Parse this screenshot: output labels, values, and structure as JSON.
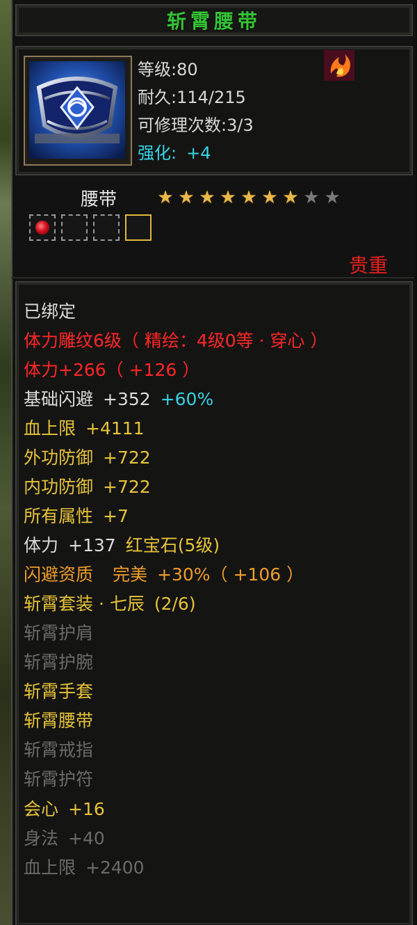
{
  "title": "斩霄腰带",
  "header": {
    "level": "等级:80",
    "durability": "耐久:114/215",
    "repair": "可修理次数:3/3",
    "enhance_label": "强化:",
    "enhance_value": "+4",
    "item_icon": "belt-icon",
    "class_icon": "flame-swirl-icon"
  },
  "type_label": "腰带",
  "stars": {
    "filled": 7,
    "total": 9
  },
  "gem_slots": [
    {
      "state": "red-gem"
    },
    {
      "state": "empty"
    },
    {
      "state": "empty"
    },
    {
      "state": "gold-empty"
    }
  ],
  "rarity": "贵重",
  "lines": {
    "bound": "已绑定",
    "engrave": "体力雕纹6级（ 精绘：4级0等 · 穿心 ）",
    "stamina_main": "体力+266（ +126 ）",
    "dodge_label": "基础闪避",
    "dodge_value": "+352",
    "dodge_pct": "+60%",
    "hp_label": "血上限",
    "hp_value": "+4111",
    "outer_def_label": "外功防御",
    "outer_def_value": "+722",
    "inner_def_label": "内功防御",
    "inner_def_value": "+722",
    "all_attr_label": "所有属性",
    "all_attr_value": "+7",
    "gem_stat_label": "体力",
    "gem_stat_value": "+137",
    "gem_name": "红宝石(5级)",
    "quality_label": "闪避资质",
    "quality_grade": "完美",
    "quality_value": "+30%（ +106 ）",
    "set_name": "斩霄套装 · 七辰",
    "set_count": "(2/6)",
    "set_piece_1": "斩霄护肩",
    "set_piece_2": "斩霄护腕",
    "set_piece_3": "斩霄手套",
    "set_piece_4": "斩霄腰带",
    "set_piece_5": "斩霄戒指",
    "set_piece_6": "斩霄护符",
    "bonus_1_label": "会心",
    "bonus_1_value": "+16",
    "bonus_2_label": "身法",
    "bonus_2_value": "+40",
    "bonus_3_label": "血上限",
    "bonus_3_value": "+2400"
  },
  "colors": {
    "title": "#35c435",
    "red": "#ff2626",
    "yellow": "#e7c33a",
    "orange": "#ef9d2a",
    "cyan": "#38d0e0",
    "gray": "#6b6b6b",
    "star_on": "#e9b84a"
  }
}
